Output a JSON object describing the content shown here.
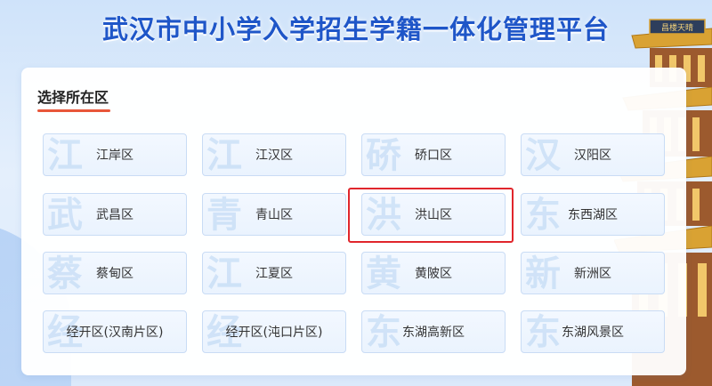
{
  "header": {
    "title": "武汉市中小学入学招生学籍一体化管理平台"
  },
  "section": {
    "title": "选择所在区"
  },
  "colors": {
    "title": "#1f56c8",
    "accent_underline": "#e8563a",
    "highlight": "#e0262c",
    "button_border": "#c9dcf5"
  },
  "pagoda_sign": "昌楼天晴",
  "districts": [
    {
      "label": "江岸区",
      "watermark": "江"
    },
    {
      "label": "江汉区",
      "watermark": "江"
    },
    {
      "label": "硚口区",
      "watermark": "硚"
    },
    {
      "label": "汉阳区",
      "watermark": "汉"
    },
    {
      "label": "武昌区",
      "watermark": "武"
    },
    {
      "label": "青山区",
      "watermark": "青"
    },
    {
      "label": "洪山区",
      "watermark": "洪"
    },
    {
      "label": "东西湖区",
      "watermark": "东"
    },
    {
      "label": "蔡甸区",
      "watermark": "蔡"
    },
    {
      "label": "江夏区",
      "watermark": "江"
    },
    {
      "label": "黄陂区",
      "watermark": "黄"
    },
    {
      "label": "新洲区",
      "watermark": "新"
    },
    {
      "label": "经开区(汉南片区)",
      "watermark": "经"
    },
    {
      "label": "经开区(沌口片区)",
      "watermark": "经"
    },
    {
      "label": "东湖高新区",
      "watermark": "东"
    },
    {
      "label": "东湖风景区",
      "watermark": "东"
    }
  ],
  "selected_district": "洪山区"
}
